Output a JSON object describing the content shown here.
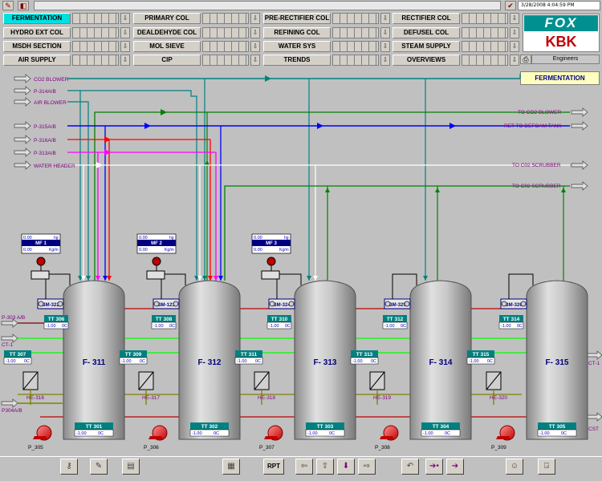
{
  "header": {
    "datetime": "3/28/2008 4:04:59 PM"
  },
  "nav": [
    {
      "label": "FERMENTATION",
      "active": true
    },
    {
      "label": "HYDRO EXT COL"
    },
    {
      "label": "MSDH SECTION"
    },
    {
      "label": "AIR SUPPLY"
    },
    {
      "label": "PRIMARY COL"
    },
    {
      "label": "DEALDEHYDE COL"
    },
    {
      "label": "MOL SIEVE"
    },
    {
      "label": "CIP"
    },
    {
      "label": "PRE-RECTIFIER COL"
    },
    {
      "label": "REFINING COL"
    },
    {
      "label": "WATER SYS"
    },
    {
      "label": "TRENDS"
    },
    {
      "label": "RECTIFIER COL"
    },
    {
      "label": "DEFUSEL COL"
    },
    {
      "label": "STEAM SUPPLY"
    },
    {
      "label": "OVERVIEWS"
    }
  ],
  "logo": {
    "top": "FOX",
    "bottom": "KBK"
  },
  "user": "Engineers",
  "display_title": "FERMENTATION",
  "inlets": [
    "CO2 BLOWER",
    "P-314A/B",
    "AIR BLOWER",
    "P-315A/B",
    "P-316A/B",
    "P-313A/B",
    "WATER HEADER"
  ],
  "outlets": [
    "TO CO2 BLOWER",
    "RET TO DEFOAM TANK",
    "TO C02 SCRUBBER",
    "TO C02 SCRUBBER"
  ],
  "left_labels": [
    "P-303 A/B",
    "CT-1",
    "P304A/B"
  ],
  "right_labels": [
    "CT-1",
    "CST"
  ],
  "flowmeters": [
    {
      "name": "MF 1",
      "v1": "0.00",
      "u1": "hg",
      "v2": "0.00",
      "u2": "Kg/m"
    },
    {
      "name": "MF 2",
      "v1": "0.00",
      "u1": "hg",
      "v2": "0.00",
      "u2": "Kg/m"
    },
    {
      "name": "MF 3",
      "v1": "0.00",
      "u1": "hg",
      "v2": "0.00",
      "u2": "Kg/m"
    }
  ],
  "tanks": [
    {
      "name": "F- 311",
      "bm": "BM-322",
      "tt_top": "TT 306",
      "tt_mid": "TT 307",
      "tt_bot": "TT 301",
      "he": "HE-316",
      "pump": "P_305"
    },
    {
      "name": "F- 312",
      "bm": "BM-123",
      "tt_top": "TT 308",
      "tt_mid": "TT 309",
      "tt_bot": "TT 302",
      "he": "HE-317",
      "pump": "P_306"
    },
    {
      "name": "F- 313",
      "bm": "BM-324",
      "tt_top": "TT 310",
      "tt_mid": "TT 311",
      "tt_bot": "TT 303",
      "he": "HE-318",
      "pump": "P_307"
    },
    {
      "name": "F- 314",
      "bm": "BM-325",
      "tt_top": "TT 312",
      "tt_mid": "TT 313",
      "tt_bot": "TT 304",
      "he": "HE-319",
      "pump": "P_308"
    },
    {
      "name": "F- 315",
      "bm": "BM-326",
      "tt_top": "TT 314",
      "tt_mid": "TT 315",
      "tt_bot": "TT 305",
      "he": "HE-320",
      "pump": "P_309"
    }
  ],
  "tt_value": "-1.00",
  "tt_unit": "0C",
  "bottom": {
    "rpt": "RPT"
  }
}
